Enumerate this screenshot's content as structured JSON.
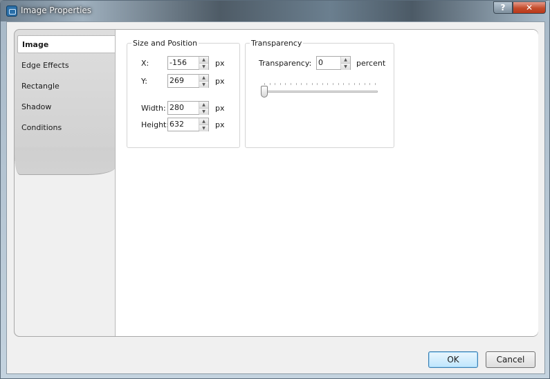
{
  "window": {
    "title": "Image Properties",
    "help_label": "?",
    "close_label": "✕"
  },
  "tabs": [
    {
      "label": "Image",
      "active": true
    },
    {
      "label": "Edge Effects",
      "active": false
    },
    {
      "label": "Rectangle",
      "active": false
    },
    {
      "label": "Shadow",
      "active": false
    },
    {
      "label": "Conditions",
      "active": false
    }
  ],
  "size_position": {
    "title": "Size and Position",
    "x": {
      "label": "X:",
      "value": "-156",
      "unit": "px"
    },
    "y": {
      "label": "Y:",
      "value": "269",
      "unit": "px"
    },
    "width": {
      "label": "Width:",
      "value": "280",
      "unit": "px"
    },
    "height": {
      "label": "Height:",
      "value": "632",
      "unit": "px"
    }
  },
  "transparency": {
    "title": "Transparency",
    "label": "Transparency:",
    "value": "0",
    "unit": "percent",
    "slider_level": 0
  },
  "buttons": {
    "ok": "OK",
    "cancel": "Cancel"
  },
  "colors": {
    "accent": "#3c7fb1",
    "close": "#c44c2c"
  }
}
